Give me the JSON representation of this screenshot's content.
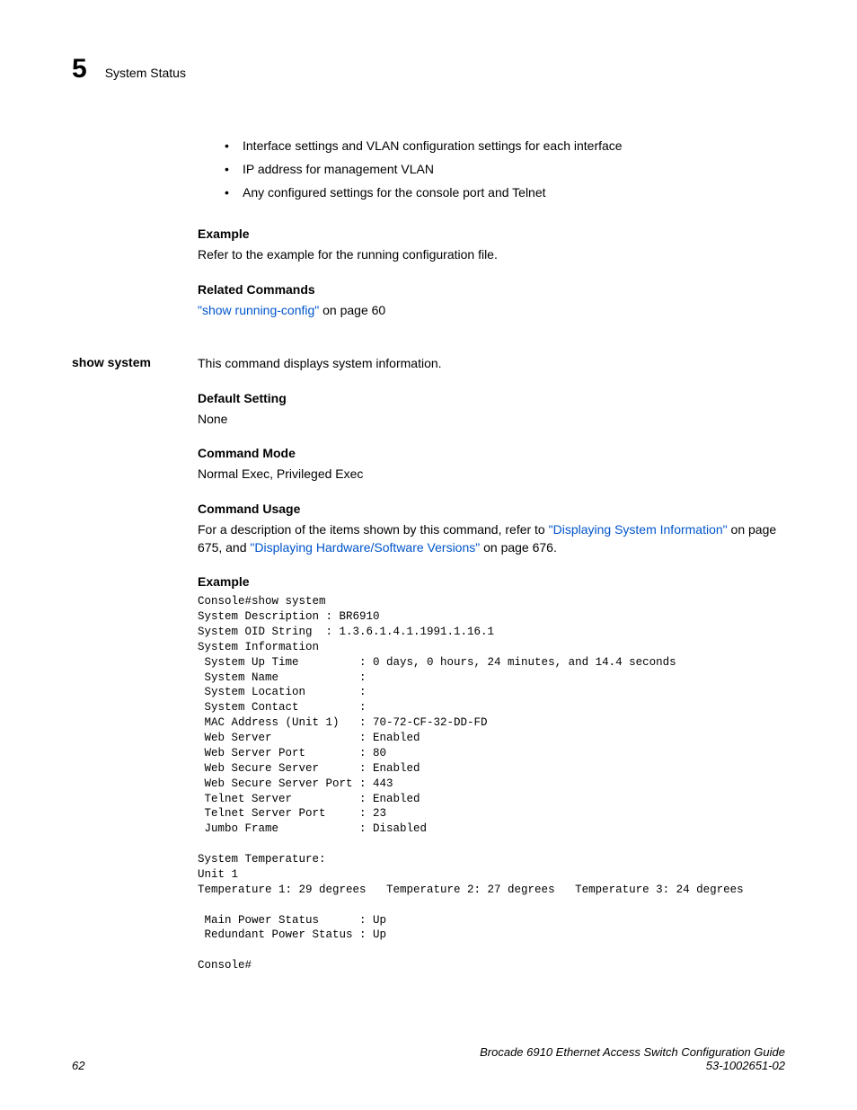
{
  "header": {
    "chapter_number": "5",
    "chapter_title": "System Status"
  },
  "bullets": {
    "b1": "Interface settings and VLAN configuration settings for each interface",
    "b2": "IP address for management VLAN",
    "b3": "Any configured settings for the console port and Telnet"
  },
  "sec1": {
    "heading": "Example",
    "text": "Refer to the example for the running configuration file."
  },
  "sec2": {
    "heading": "Related Commands",
    "link_text": "\"show running-config\"",
    "suffix": " on page 60"
  },
  "cmd": {
    "name": "show system",
    "intro": "This command displays system information."
  },
  "sec3": {
    "heading": "Default Setting",
    "text": "None"
  },
  "sec4": {
    "heading": "Command Mode",
    "text": "Normal Exec, Privileged Exec"
  },
  "sec5": {
    "heading": "Command Usage",
    "prefix": "For a description of the items shown by this command, refer to ",
    "link1": "\"Displaying System Information\"",
    "mid": " on page 675, and ",
    "link2": "\"Displaying Hardware/Software Versions\"",
    "suffix": " on page 676."
  },
  "sec6": {
    "heading": "Example",
    "console": "Console#show system\nSystem Description : BR6910\nSystem OID String  : 1.3.6.1.4.1.1991.1.16.1\nSystem Information\n System Up Time         : 0 days, 0 hours, 24 minutes, and 14.4 seconds\n System Name            :\n System Location        :\n System Contact         :\n MAC Address (Unit 1)   : 70-72-CF-32-DD-FD\n Web Server             : Enabled\n Web Server Port        : 80\n Web Secure Server      : Enabled\n Web Secure Server Port : 443\n Telnet Server          : Enabled\n Telnet Server Port     : 23\n Jumbo Frame            : Disabled\n\nSystem Temperature:\nUnit 1\nTemperature 1: 29 degrees   Temperature 2: 27 degrees   Temperature 3: 24 degrees\n\n Main Power Status      : Up\n Redundant Power Status : Up\n\nConsole#"
  },
  "footer": {
    "page_number": "62",
    "book_title": "Brocade 6910 Ethernet Access Switch Configuration Guide",
    "doc_number": "53-1002651-02"
  }
}
